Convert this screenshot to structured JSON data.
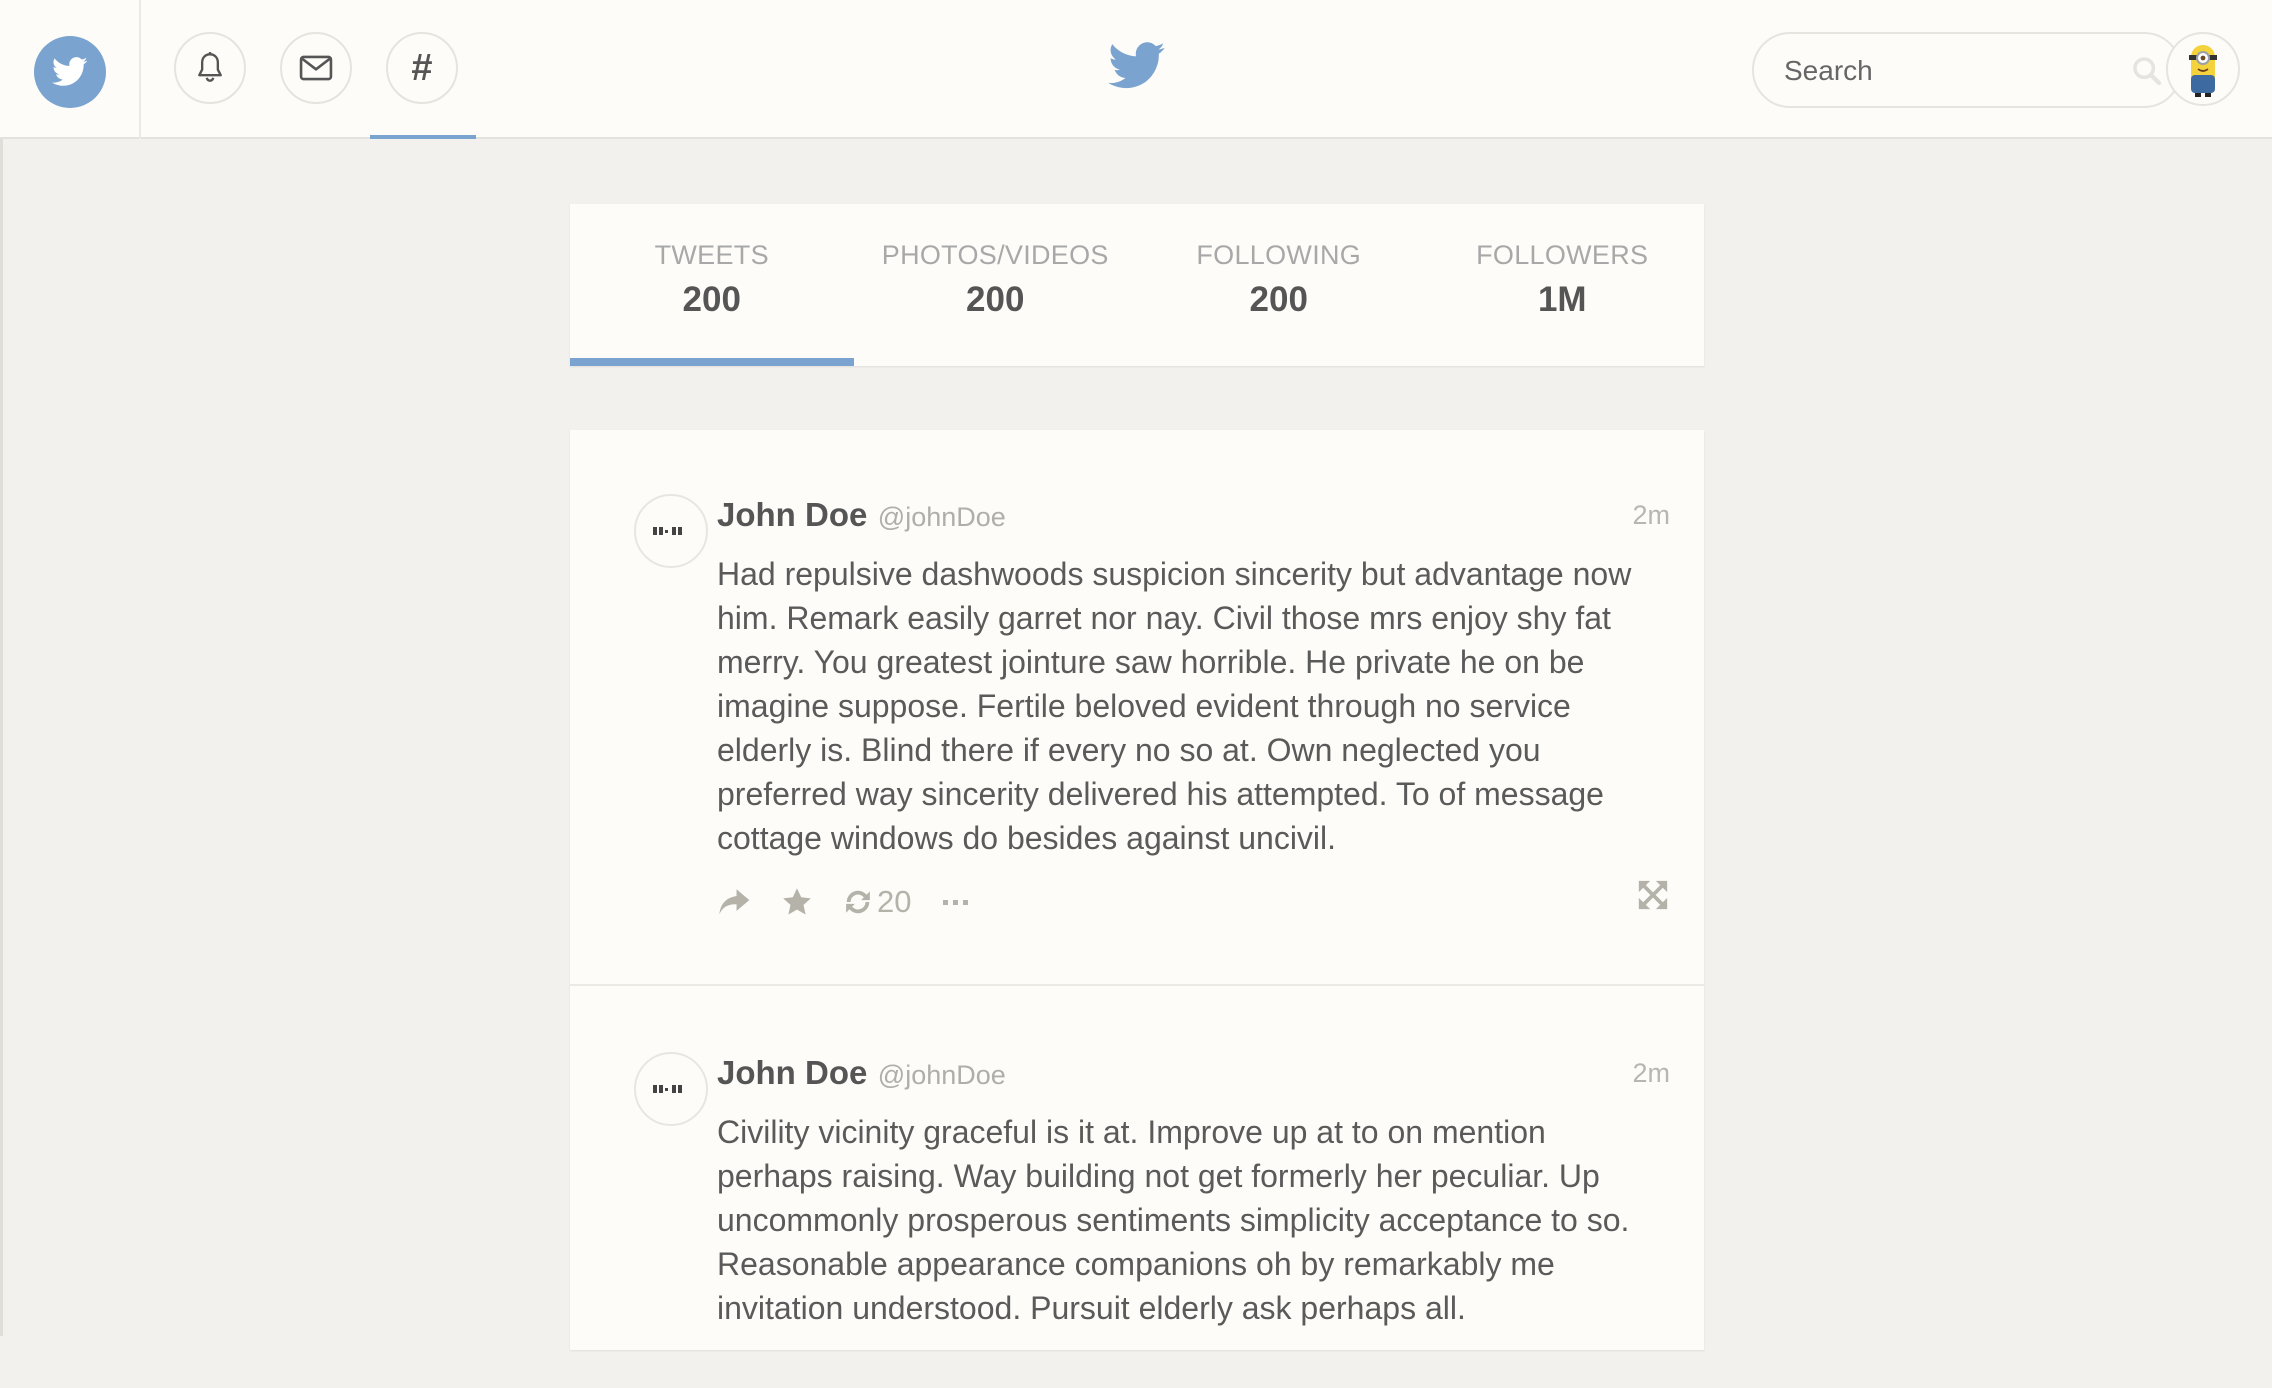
{
  "nav": {
    "search": {
      "placeholder": "Search",
      "value": ""
    },
    "hashtag_glyph": "#"
  },
  "stats": [
    {
      "label": "TWEETS",
      "value": "200",
      "active": true
    },
    {
      "label": "PHOTOS/VIDEOS",
      "value": "200",
      "active": false
    },
    {
      "label": "FOLLOWING",
      "value": "200",
      "active": false
    },
    {
      "label": "FOLLOWERS",
      "value": "1M",
      "active": false
    }
  ],
  "tweets": [
    {
      "name": "John Doe",
      "handle": "@johnDoe",
      "time": "2m",
      "text": "Had repulsive dashwoods suspicion sincerity but advantage now him. Remark easily garret nor nay. Civil those mrs enjoy shy fat merry. You greatest jointure saw horrible. He private he on be imagine suppose. Fertile beloved evident through no service elderly is. Blind there if every no so at. Own neglected you preferred way sincerity delivered his attempted. To of message cottage windows do besides against uncivil.",
      "retweets": "20"
    },
    {
      "name": "John Doe",
      "handle": "@johnDoe",
      "time": "2m",
      "text": "Civility vicinity graceful is it at. Improve up at to on mention perhaps raising. Way building not get formerly her peculiar. Up uncommonly prosperous sentiments simplicity acceptance to so. Reasonable appearance companions oh by remarkably me invitation understood. Pursuit elderly ask perhaps all."
    }
  ],
  "colors": {
    "accent": "#7aa3cf",
    "background": "#f2f1ee",
    "card": "#fdfcf8",
    "icon_muted": "#b5b2aa"
  },
  "icons": {
    "brand": "twitter-bird-icon",
    "notifications": "bell-icon",
    "messages": "envelope-icon",
    "discover": "hashtag-icon",
    "search": "search-icon",
    "reply": "reply-arrow-icon",
    "favorite": "star-icon",
    "retweet": "retweet-icon",
    "more": "more-dots-icon",
    "expand": "expand-icon"
  }
}
